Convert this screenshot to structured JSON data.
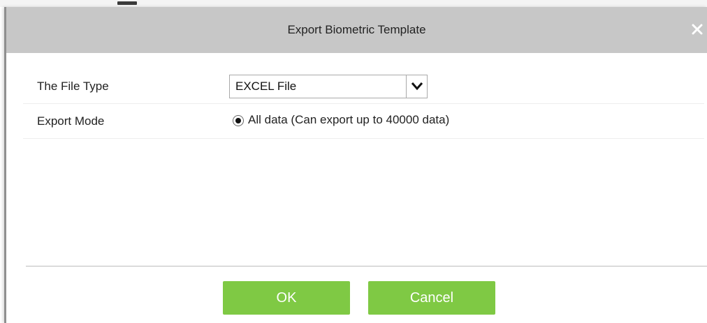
{
  "dialog": {
    "title": "Export Biometric Template",
    "close_icon": "close-icon"
  },
  "form": {
    "file_type_label": "The File Type",
    "file_type_value": "EXCEL File",
    "export_mode_label": "Export Mode",
    "export_mode_option": "All data (Can export up to 40000 data)",
    "export_mode_selected": true
  },
  "footer": {
    "ok_label": "OK",
    "cancel_label": "Cancel"
  },
  "colors": {
    "titlebar": "#c7c7c7",
    "button": "#7fc944",
    "button_text": "#ffffff"
  }
}
